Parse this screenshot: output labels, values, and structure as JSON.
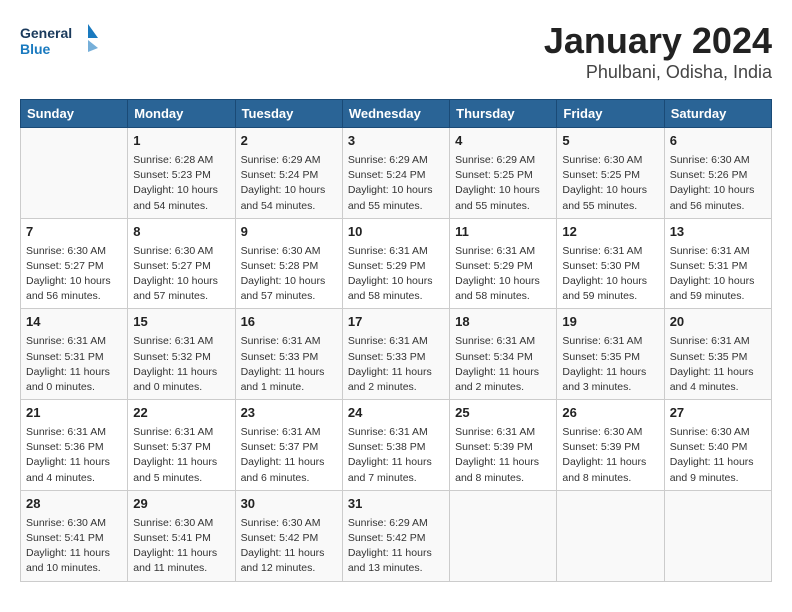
{
  "header": {
    "logo_line1": "General",
    "logo_line2": "Blue",
    "title": "January 2024",
    "subtitle": "Phulbani, Odisha, India"
  },
  "weekdays": [
    "Sunday",
    "Monday",
    "Tuesday",
    "Wednesday",
    "Thursday",
    "Friday",
    "Saturday"
  ],
  "weeks": [
    [
      {
        "day": "",
        "info": ""
      },
      {
        "day": "1",
        "info": "Sunrise: 6:28 AM\nSunset: 5:23 PM\nDaylight: 10 hours\nand 54 minutes."
      },
      {
        "day": "2",
        "info": "Sunrise: 6:29 AM\nSunset: 5:24 PM\nDaylight: 10 hours\nand 54 minutes."
      },
      {
        "day": "3",
        "info": "Sunrise: 6:29 AM\nSunset: 5:24 PM\nDaylight: 10 hours\nand 55 minutes."
      },
      {
        "day": "4",
        "info": "Sunrise: 6:29 AM\nSunset: 5:25 PM\nDaylight: 10 hours\nand 55 minutes."
      },
      {
        "day": "5",
        "info": "Sunrise: 6:30 AM\nSunset: 5:25 PM\nDaylight: 10 hours\nand 55 minutes."
      },
      {
        "day": "6",
        "info": "Sunrise: 6:30 AM\nSunset: 5:26 PM\nDaylight: 10 hours\nand 56 minutes."
      }
    ],
    [
      {
        "day": "7",
        "info": "Sunrise: 6:30 AM\nSunset: 5:27 PM\nDaylight: 10 hours\nand 56 minutes."
      },
      {
        "day": "8",
        "info": "Sunrise: 6:30 AM\nSunset: 5:27 PM\nDaylight: 10 hours\nand 57 minutes."
      },
      {
        "day": "9",
        "info": "Sunrise: 6:30 AM\nSunset: 5:28 PM\nDaylight: 10 hours\nand 57 minutes."
      },
      {
        "day": "10",
        "info": "Sunrise: 6:31 AM\nSunset: 5:29 PM\nDaylight: 10 hours\nand 58 minutes."
      },
      {
        "day": "11",
        "info": "Sunrise: 6:31 AM\nSunset: 5:29 PM\nDaylight: 10 hours\nand 58 minutes."
      },
      {
        "day": "12",
        "info": "Sunrise: 6:31 AM\nSunset: 5:30 PM\nDaylight: 10 hours\nand 59 minutes."
      },
      {
        "day": "13",
        "info": "Sunrise: 6:31 AM\nSunset: 5:31 PM\nDaylight: 10 hours\nand 59 minutes."
      }
    ],
    [
      {
        "day": "14",
        "info": "Sunrise: 6:31 AM\nSunset: 5:31 PM\nDaylight: 11 hours\nand 0 minutes."
      },
      {
        "day": "15",
        "info": "Sunrise: 6:31 AM\nSunset: 5:32 PM\nDaylight: 11 hours\nand 0 minutes."
      },
      {
        "day": "16",
        "info": "Sunrise: 6:31 AM\nSunset: 5:33 PM\nDaylight: 11 hours\nand 1 minute."
      },
      {
        "day": "17",
        "info": "Sunrise: 6:31 AM\nSunset: 5:33 PM\nDaylight: 11 hours\nand 2 minutes."
      },
      {
        "day": "18",
        "info": "Sunrise: 6:31 AM\nSunset: 5:34 PM\nDaylight: 11 hours\nand 2 minutes."
      },
      {
        "day": "19",
        "info": "Sunrise: 6:31 AM\nSunset: 5:35 PM\nDaylight: 11 hours\nand 3 minutes."
      },
      {
        "day": "20",
        "info": "Sunrise: 6:31 AM\nSunset: 5:35 PM\nDaylight: 11 hours\nand 4 minutes."
      }
    ],
    [
      {
        "day": "21",
        "info": "Sunrise: 6:31 AM\nSunset: 5:36 PM\nDaylight: 11 hours\nand 4 minutes."
      },
      {
        "day": "22",
        "info": "Sunrise: 6:31 AM\nSunset: 5:37 PM\nDaylight: 11 hours\nand 5 minutes."
      },
      {
        "day": "23",
        "info": "Sunrise: 6:31 AM\nSunset: 5:37 PM\nDaylight: 11 hours\nand 6 minutes."
      },
      {
        "day": "24",
        "info": "Sunrise: 6:31 AM\nSunset: 5:38 PM\nDaylight: 11 hours\nand 7 minutes."
      },
      {
        "day": "25",
        "info": "Sunrise: 6:31 AM\nSunset: 5:39 PM\nDaylight: 11 hours\nand 8 minutes."
      },
      {
        "day": "26",
        "info": "Sunrise: 6:30 AM\nSunset: 5:39 PM\nDaylight: 11 hours\nand 8 minutes."
      },
      {
        "day": "27",
        "info": "Sunrise: 6:30 AM\nSunset: 5:40 PM\nDaylight: 11 hours\nand 9 minutes."
      }
    ],
    [
      {
        "day": "28",
        "info": "Sunrise: 6:30 AM\nSunset: 5:41 PM\nDaylight: 11 hours\nand 10 minutes."
      },
      {
        "day": "29",
        "info": "Sunrise: 6:30 AM\nSunset: 5:41 PM\nDaylight: 11 hours\nand 11 minutes."
      },
      {
        "day": "30",
        "info": "Sunrise: 6:30 AM\nSunset: 5:42 PM\nDaylight: 11 hours\nand 12 minutes."
      },
      {
        "day": "31",
        "info": "Sunrise: 6:29 AM\nSunset: 5:42 PM\nDaylight: 11 hours\nand 13 minutes."
      },
      {
        "day": "",
        "info": ""
      },
      {
        "day": "",
        "info": ""
      },
      {
        "day": "",
        "info": ""
      }
    ]
  ]
}
